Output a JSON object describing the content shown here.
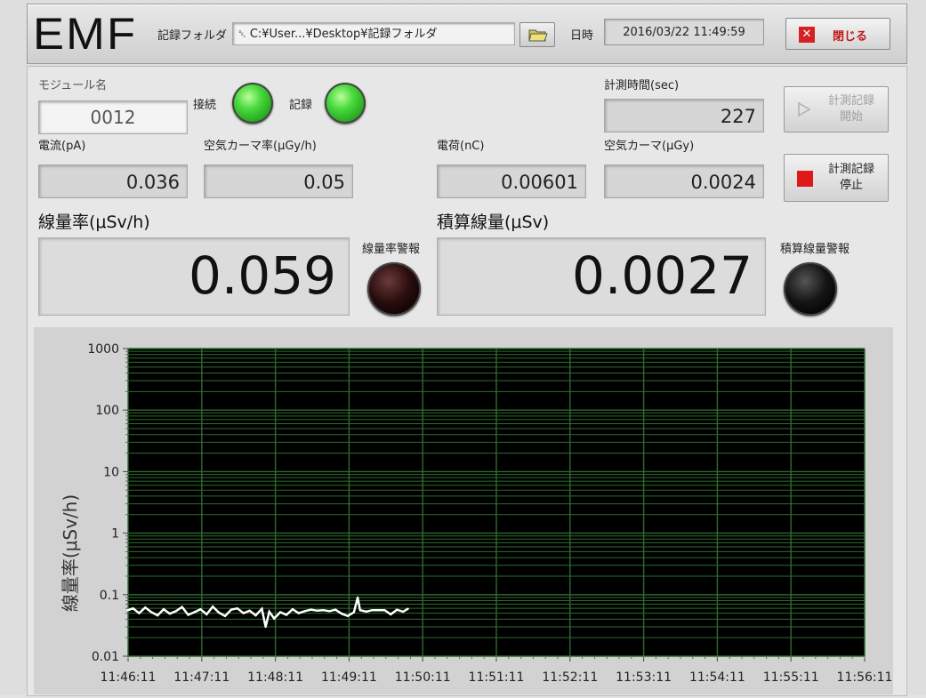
{
  "app": {
    "logo": "EMF",
    "folder_label": "記録フォルダ",
    "folder_path": "C:¥User...¥Desktop¥記録フォルダ",
    "datetime_label": "日時",
    "datetime_value": "2016/03/22 11:49:59",
    "close_label": "閉じる"
  },
  "module": {
    "label": "モジュール名",
    "value": "0012"
  },
  "indicators": {
    "connect_label": "接続",
    "record_label": "記録",
    "rate_alarm_label": "線量率警報",
    "dose_alarm_label": "積算線量警報",
    "connect_color": "#3fd23a",
    "record_color": "#3fd23a",
    "rate_alarm_color": "#2a0d0d",
    "dose_alarm_color": "#151515"
  },
  "measure": {
    "time_label": "計測時間(sec)",
    "time_value": "227",
    "current_label": "電流(pA)",
    "current_value": "0.036",
    "air_kerma_rate_label": "空気カーマ率(μGy/h)",
    "air_kerma_rate_value": "0.05",
    "charge_label": "電荷(nC)",
    "charge_value": "0.00601",
    "air_kerma_label": "空気カーマ(μGy)",
    "air_kerma_value": "0.0024",
    "dose_rate_label": "線量率(μSv/h)",
    "dose_rate_value": "0.059",
    "dose_total_label": "積算線量(μSv)",
    "dose_total_value": "0.0027"
  },
  "buttons": {
    "start_label_1": "計測記録",
    "start_label_2": "開始",
    "stop_label_1": "計測記録",
    "stop_label_2": "停止",
    "stop_color": "#e01818"
  },
  "chart_data": {
    "type": "line",
    "ylabel": "線量率(μSv/h)",
    "yscale": "log",
    "ylim": [
      0.01,
      1000
    ],
    "yticks": [
      "1000",
      "100",
      "10",
      "1",
      "0.1",
      "0.01"
    ],
    "xlim": [
      "11:46:11",
      "11:56:11"
    ],
    "xticks": [
      "11:46:11",
      "11:47:11",
      "11:48:11",
      "11:49:11",
      "11:50:11",
      "11:51:11",
      "11:52:11",
      "11:53:11",
      "11:54:11",
      "11:55:11",
      "11:56:11"
    ],
    "background": "#000000",
    "grid_color": "#2e6b2e",
    "line_color": "#ffffff",
    "grid": true,
    "series": [
      {
        "x": [
          "11:46:11",
          "11:46:15",
          "11:46:20",
          "11:46:25",
          "11:46:30",
          "11:46:35",
          "11:46:40",
          "11:46:45",
          "11:46:50",
          "11:46:55",
          "11:47:00",
          "11:47:05",
          "11:47:10",
          "11:47:15",
          "11:47:20",
          "11:47:25",
          "11:47:30",
          "11:47:35",
          "11:47:40",
          "11:47:45",
          "11:47:50",
          "11:47:55",
          "11:48:00",
          "11:48:03",
          "11:48:06",
          "11:48:10",
          "11:48:15",
          "11:48:20",
          "11:48:25",
          "11:48:30",
          "11:48:35",
          "11:48:40",
          "11:48:45",
          "11:48:50",
          "11:48:55",
          "11:49:00",
          "11:49:05",
          "11:49:10",
          "11:49:15",
          "11:49:18",
          "11:49:20",
          "11:49:25",
          "11:49:30",
          "11:49:35",
          "11:49:40",
          "11:49:45",
          "11:49:50",
          "11:49:55",
          "11:49:59"
        ],
        "y": [
          0.056,
          0.06,
          0.05,
          0.062,
          0.052,
          0.046,
          0.058,
          0.049,
          0.054,
          0.063,
          0.047,
          0.052,
          0.058,
          0.048,
          0.064,
          0.051,
          0.045,
          0.057,
          0.06,
          0.05,
          0.055,
          0.046,
          0.059,
          0.03,
          0.053,
          0.041,
          0.052,
          0.047,
          0.058,
          0.05,
          0.054,
          0.057,
          0.055,
          0.056,
          0.054,
          0.057,
          0.049,
          0.045,
          0.052,
          0.09,
          0.056,
          0.053,
          0.056,
          0.056,
          0.056,
          0.048,
          0.057,
          0.053,
          0.059
        ]
      }
    ]
  }
}
